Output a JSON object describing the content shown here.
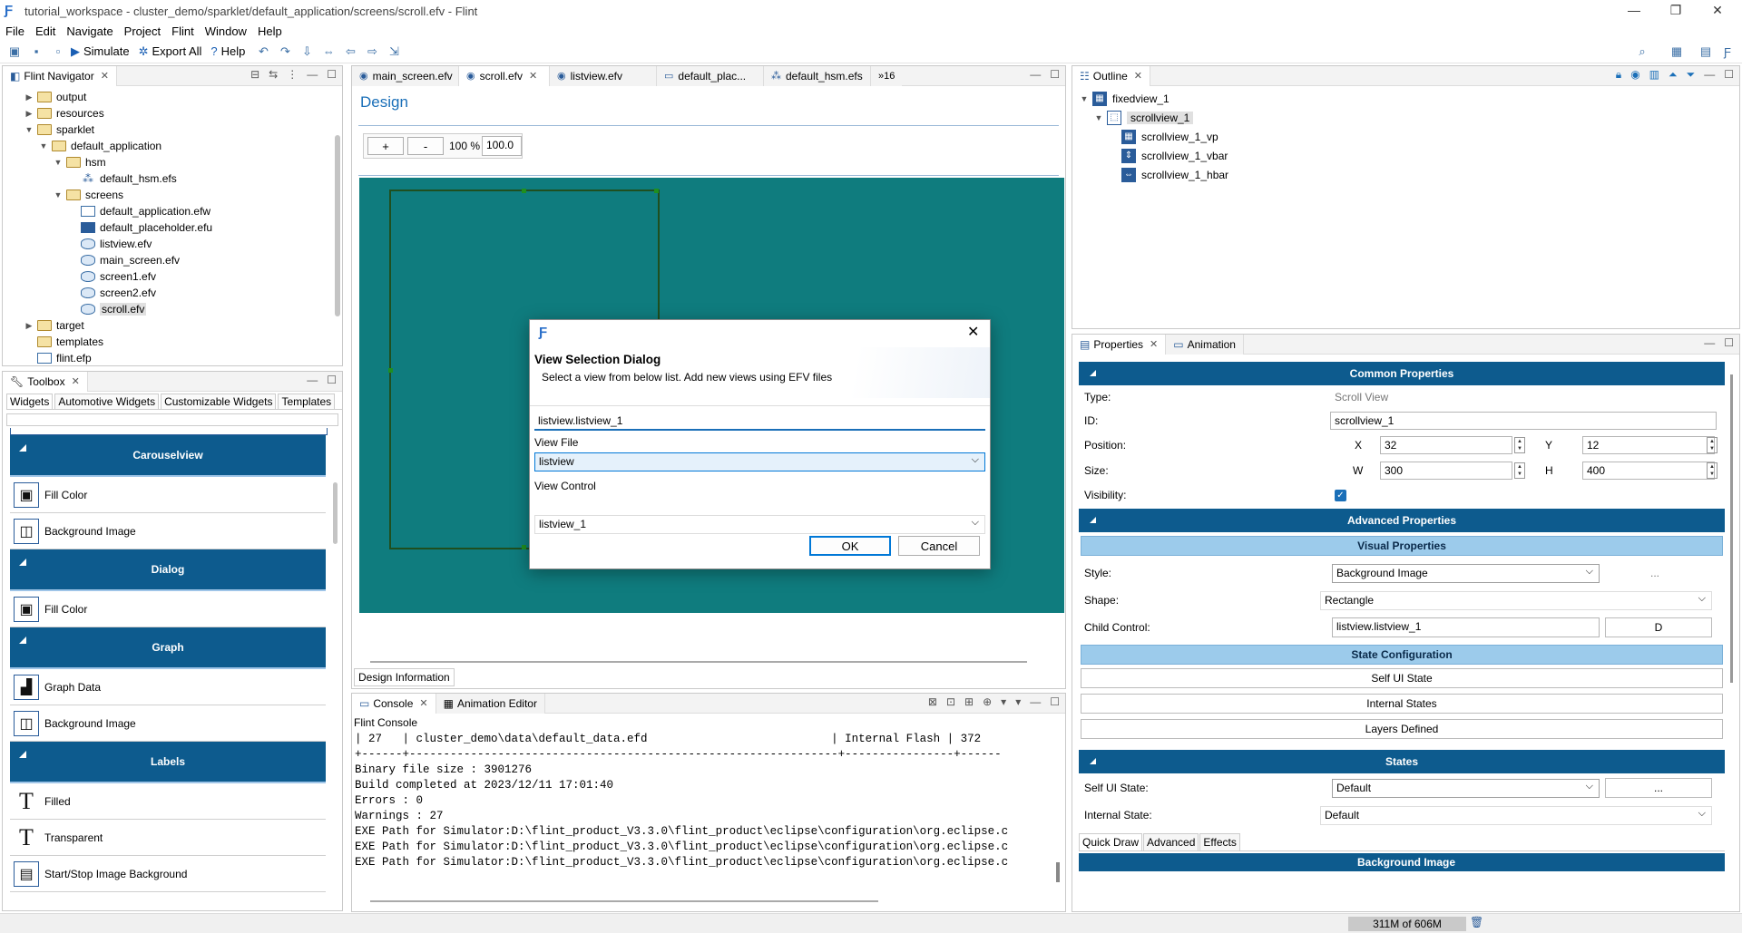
{
  "window": {
    "title": "tutorial_workspace - cluster_demo/sparklet/default_application/screens/scroll.efv - Flint"
  },
  "menu": [
    "File",
    "Edit",
    "Navigate",
    "Project",
    "Flint",
    "Window",
    "Help"
  ],
  "toolbar": {
    "simulate": "Simulate",
    "export_all": "Export All",
    "help": "Help"
  },
  "navigator": {
    "tab": "Flint Navigator",
    "items": [
      {
        "label": "output",
        "depth": 1,
        "tw": "▶",
        "icon": "folder"
      },
      {
        "label": "resources",
        "depth": 1,
        "tw": "▶",
        "icon": "folder"
      },
      {
        "label": "sparklet",
        "depth": 1,
        "tw": "▼",
        "icon": "folder"
      },
      {
        "label": "default_application",
        "depth": 2,
        "tw": "▼",
        "icon": "folder"
      },
      {
        "label": "hsm",
        "depth": 3,
        "tw": "▼",
        "icon": "folder"
      },
      {
        "label": "default_hsm.efs",
        "depth": 4,
        "tw": "",
        "icon": "efs"
      },
      {
        "label": "screens",
        "depth": 3,
        "tw": "▼",
        "icon": "folder"
      },
      {
        "label": "default_application.efw",
        "depth": 4,
        "tw": "",
        "icon": "efw"
      },
      {
        "label": "default_placeholder.efu",
        "depth": 4,
        "tw": "",
        "icon": "efu"
      },
      {
        "label": "listview.efv",
        "depth": 4,
        "tw": "",
        "icon": "efv"
      },
      {
        "label": "main_screen.efv",
        "depth": 4,
        "tw": "",
        "icon": "efv"
      },
      {
        "label": "screen1.efv",
        "depth": 4,
        "tw": "",
        "icon": "efv"
      },
      {
        "label": "screen2.efv",
        "depth": 4,
        "tw": "",
        "icon": "efv"
      },
      {
        "label": "scroll.efv",
        "depth": 4,
        "tw": "",
        "icon": "efv",
        "selected": true
      },
      {
        "label": "target",
        "depth": 1,
        "tw": "▶",
        "icon": "folder"
      },
      {
        "label": "templates",
        "depth": 1,
        "tw": "",
        "icon": "folder"
      },
      {
        "label": "flint.efp",
        "depth": 1,
        "tw": "",
        "icon": "efw"
      }
    ]
  },
  "toolbox": {
    "tab": "Toolbox",
    "tabs": [
      "Widgets",
      "Automotive Widgets",
      "Customizable Widgets",
      "Templates"
    ],
    "groups": [
      {
        "label": "Carouselview",
        "items": [
          "Fill Color",
          "Background Image"
        ]
      },
      {
        "label": "Dialog",
        "items": [
          "Fill Color"
        ]
      },
      {
        "label": "Graph",
        "items": [
          "Graph Data",
          "Background Image"
        ]
      },
      {
        "label": "Labels",
        "items": [
          "Filled",
          "Transparent",
          "Start/Stop Image Background"
        ]
      }
    ]
  },
  "editor": {
    "tabs": [
      "main_screen.efv",
      "scroll.efv",
      "listview.efv",
      "default_plac...",
      "default_hsm.efs"
    ],
    "overflow": "»16",
    "design_title": "Design",
    "zoom_plus": "+",
    "zoom_minus": "-",
    "zoom_pct": "100 %",
    "zoom_val": "100.0",
    "design_info_tab": "Design Information"
  },
  "dialog": {
    "title": "View Selection Dialog",
    "subtitle": "Select a view from below list. Add new views using EFV files",
    "search_value": "listview.listview_1",
    "view_file_label": "View File",
    "view_file_value": "listview",
    "view_control_label": "View Control",
    "view_control_value": "listview_1",
    "ok": "OK",
    "cancel": "Cancel"
  },
  "console": {
    "tabs": [
      "Console",
      "Animation Editor"
    ],
    "name": "Flint Console",
    "lines": [
      "| 27   | cluster_demo\\data\\default_data.efd                           | Internal Flash | 372",
      "+------+---------------------------------------------------------------+----------------+------",
      "Binary file size : 3901276",
      "Build completed at 2023/12/11 17:01:40",
      "Errors : 0",
      "Warnings : 27",
      "EXE Path for Simulator:D:\\flint_product_V3.3.0\\flint_product\\eclipse\\configuration\\org.eclipse.c",
      "EXE Path for Simulator:D:\\flint_product_V3.3.0\\flint_product\\eclipse\\configuration\\org.eclipse.c",
      "EXE Path for Simulator:D:\\flint_product_V3.3.0\\flint_product\\eclipse\\configuration\\org.eclipse.c"
    ]
  },
  "outline": {
    "tab": "Outline",
    "items": [
      {
        "label": "fixedview_1",
        "depth": 0,
        "tw": "▼",
        "icon": "fixed"
      },
      {
        "label": "scrollview_1",
        "depth": 1,
        "tw": "▼",
        "icon": "scroll",
        "selected": true
      },
      {
        "label": "scrollview_1_vp",
        "depth": 2,
        "tw": "",
        "icon": "vp"
      },
      {
        "label": "scrollview_1_vbar",
        "depth": 2,
        "tw": "",
        "icon": "vbar"
      },
      {
        "label": "scrollview_1_hbar",
        "depth": 2,
        "tw": "",
        "icon": "hbar"
      }
    ]
  },
  "properties": {
    "tabs": [
      "Properties",
      "Animation"
    ],
    "common_header": "Common Properties",
    "type_label": "Type:",
    "type_value": "Scroll View",
    "id_label": "ID:",
    "id_value": "scrollview_1",
    "position_label": "Position:",
    "x_label": "X",
    "x_value": "32",
    "y_label": "Y",
    "y_value": "12",
    "size_label": "Size:",
    "w_label": "W",
    "w_value": "300",
    "h_label": "H",
    "h_value": "400",
    "visibility_label": "Visibility:",
    "advanced_header": "Advanced Properties",
    "visual_header": "Visual Properties",
    "style_label": "Style:",
    "style_value": "Background Image",
    "style_btn": "...",
    "shape_label": "Shape:",
    "shape_value": "Rectangle",
    "child_label": "Child Control:",
    "child_value": "listview.listview_1",
    "child_btn": "D",
    "state_config_header": "State Configuration",
    "self_ui_state_btn": "Self UI State",
    "internal_states_btn": "Internal States",
    "layers_defined_btn": "Layers Defined",
    "states_header": "States",
    "self_ui_label": "Self UI State:",
    "self_ui_value": "Default",
    "self_ui_btn": "...",
    "internal_label": "Internal State:",
    "internal_value": "Default",
    "bottom_tabs": [
      "Quick Draw",
      "Advanced",
      "Effects"
    ],
    "bg_header": "Background Image"
  },
  "status": {
    "memory": "311M of 606M"
  }
}
